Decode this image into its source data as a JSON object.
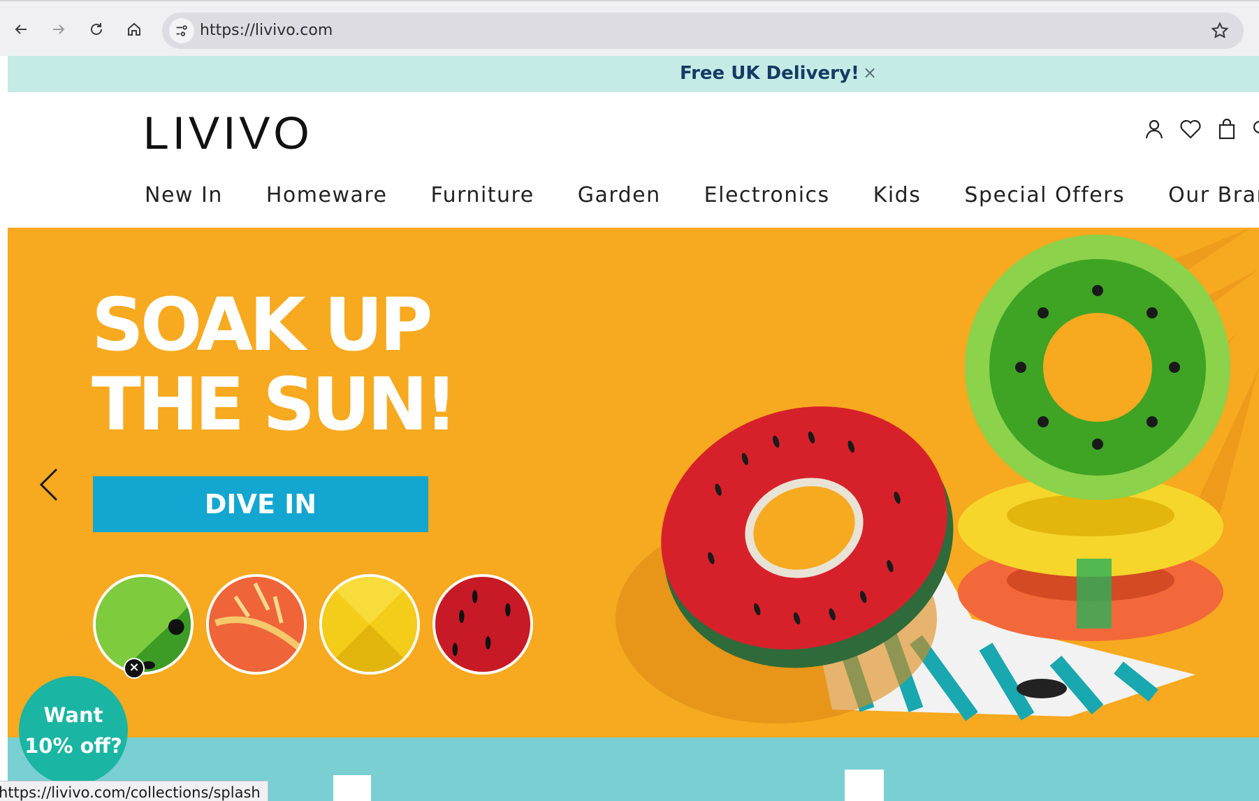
{
  "browser": {
    "url": "https://livivo.com",
    "status_url": "https://livivo.com/collections/splash",
    "icons": [
      "back-icon",
      "forward-icon",
      "reload-icon",
      "home-icon",
      "page-settings-icon",
      "bookmark-star-icon"
    ]
  },
  "announcement": {
    "text": "Free UK Delivery!",
    "close": "×"
  },
  "header": {
    "logo": "LIVIVO",
    "icons": [
      "account-icon",
      "wishlist-heart-icon",
      "cart-bag-icon"
    ]
  },
  "nav": {
    "items": [
      "New In",
      "Homeware",
      "Furniture",
      "Garden",
      "Electronics",
      "Kids",
      "Special Offers",
      "Our Brar"
    ]
  },
  "hero": {
    "title_line1": "SOAK UP",
    "title_line2": "THE SUN!",
    "cta": "DIVE IN",
    "prev_icon": "chevron-left-icon",
    "swatches": [
      "kiwi",
      "tropical",
      "pineapple",
      "watermelon"
    ]
  },
  "promo": {
    "line1": "Want",
    "line2": "10% off?",
    "close": "×"
  },
  "colors": {
    "hero_bg": "#f7a91f",
    "cta_bg": "#12a6d0",
    "announce_bg": "#c5ebe6",
    "promo_bg": "#1ab5a3",
    "band_bg": "#7acfd2"
  }
}
